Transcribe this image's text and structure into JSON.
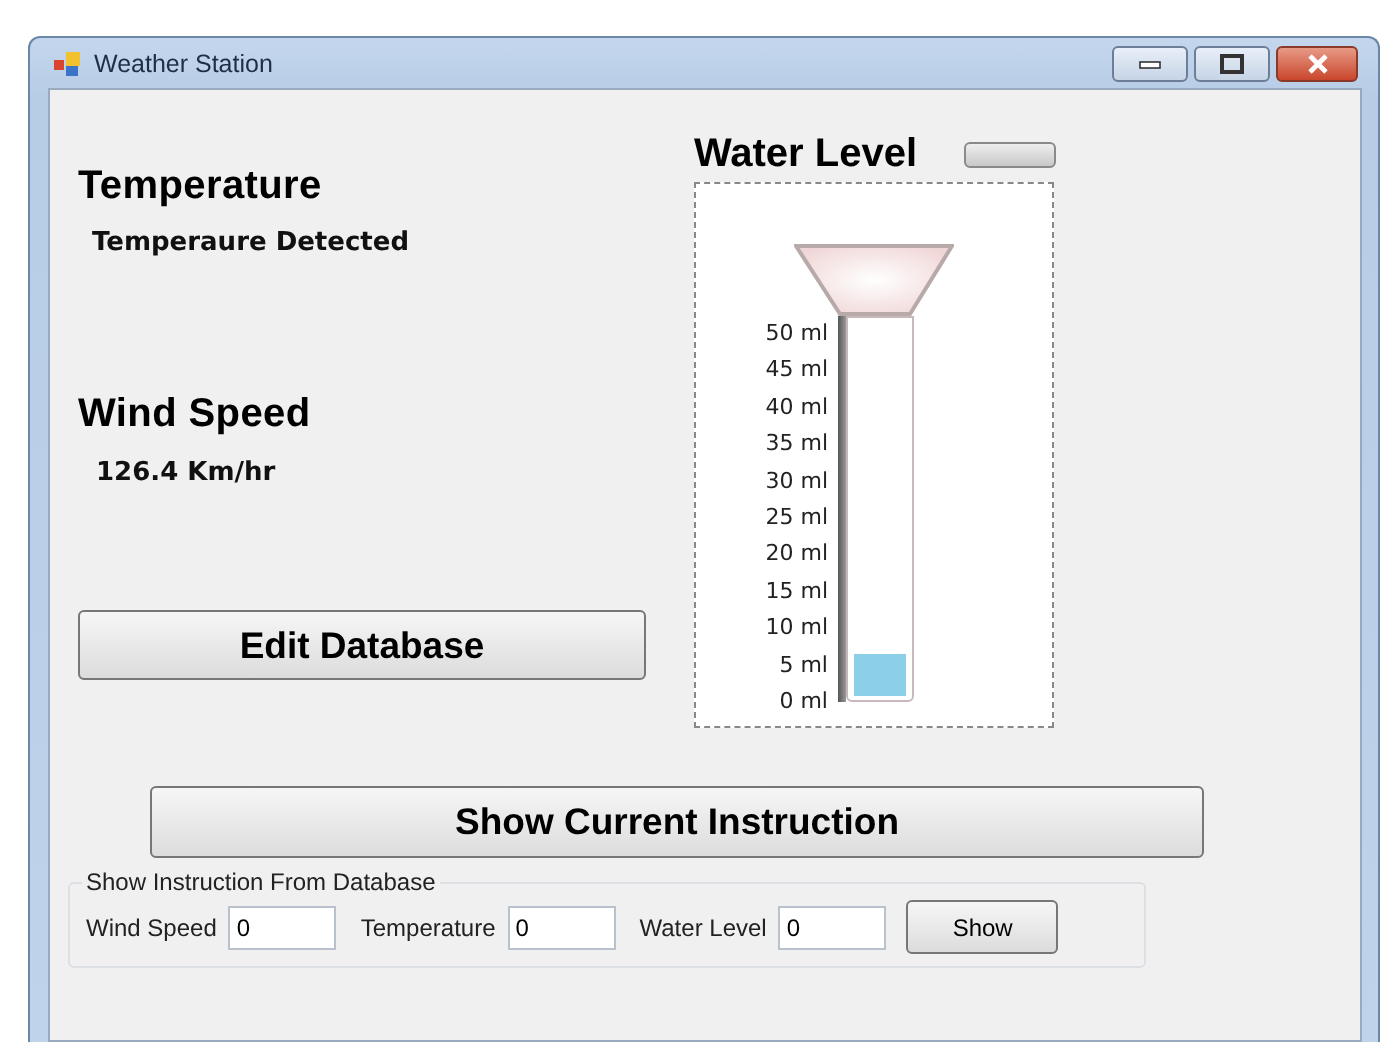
{
  "window": {
    "title": "Weather Station"
  },
  "temperature": {
    "heading": "Temperature",
    "value": "Temperaure Detected"
  },
  "wind_speed": {
    "heading": "Wind Speed",
    "value": "126.4 Km/hr"
  },
  "edit_button": "Edit Database",
  "water_level": {
    "heading": "Water Level",
    "scale": [
      "50 ml",
      "45 ml",
      "40 ml",
      "35 ml",
      "30 ml",
      "25 ml",
      "20 ml",
      "15 ml",
      "10 ml",
      "5 ml",
      "0 ml"
    ],
    "level": 0.11
  },
  "show_current_button": "Show Current Instruction",
  "database_group": {
    "title": "Show Instruction From Database",
    "fields": [
      {
        "label": "Wind Speed",
        "value": "0"
      },
      {
        "label": "Temperature",
        "value": "0"
      },
      {
        "label": "Water Level",
        "value": "0"
      }
    ],
    "button": "Show"
  }
}
